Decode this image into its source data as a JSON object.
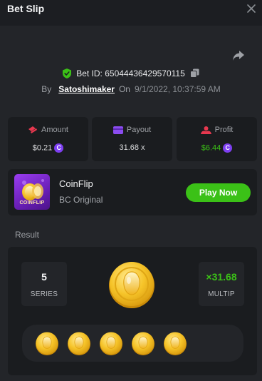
{
  "header": {
    "title": "Bet Slip"
  },
  "bet": {
    "id_text": "Bet ID: 65044436429570115",
    "by_label": "By",
    "username": "Satoshimaker",
    "on_label": "On",
    "datetime": "9/1/2022, 10:37:59 AM"
  },
  "stats": {
    "amount": {
      "label": "Amount",
      "value": "$0.21"
    },
    "payout": {
      "label": "Payout",
      "value": "31.68 x"
    },
    "profit": {
      "label": "Profit",
      "value": "$6.44"
    }
  },
  "game": {
    "thumb_text": "COINFLIP",
    "name": "CoinFlip",
    "subtitle": "BC Original",
    "play_label": "Play Now"
  },
  "result": {
    "label": "Result",
    "series_value": "5",
    "series_label": "SERIES",
    "multiplier_value": "×31.68",
    "multiplier_label": "MULTIP",
    "coins": [
      "heads",
      "heads",
      "heads",
      "heads",
      "heads"
    ]
  },
  "colors": {
    "accent_green": "#3bc117",
    "currency_purple": "#7e3ff2",
    "coin_gold": "#f5c22a"
  },
  "icons": {
    "close": "close-icon",
    "share": "share-icon",
    "verified": "shield-check-icon",
    "copy": "copy-icon",
    "amount": "bet-icon",
    "payout": "wallet-icon",
    "profit": "profit-icon"
  }
}
